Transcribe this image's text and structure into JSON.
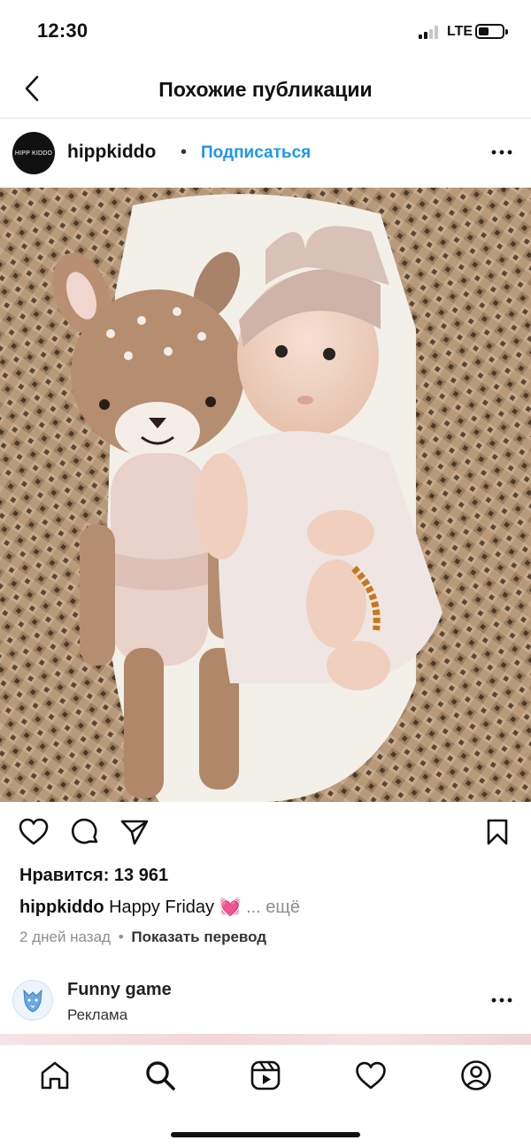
{
  "status_bar": {
    "time": "12:30",
    "network": "LTE",
    "signal_bars": 2
  },
  "header": {
    "title": "Похожие публикации",
    "back_icon": "chevron-left-icon"
  },
  "post": {
    "avatar_text": "HIPP KIDDO",
    "username": "hippkiddo",
    "separator": "•",
    "follow_label": "Подписаться",
    "more_icon": "more-horizontal-icon",
    "likes_text": "Нравится: 13 961",
    "caption_user": "hippkiddo",
    "caption_text": "Happy Friday",
    "caption_emoji": "💓",
    "caption_more": "... ещё",
    "time_ago": "2 дней назад",
    "meta_separator": "•",
    "translate_label": "Показать перевод"
  },
  "ad": {
    "name": "Funny game",
    "subtitle": "Реклама"
  },
  "bottom_nav": {
    "items": [
      "home-icon",
      "search-icon",
      "reels-icon",
      "heart-icon",
      "profile-icon"
    ]
  },
  "colors": {
    "accent": "#1e96f0",
    "muted": "#8e8e8e"
  }
}
